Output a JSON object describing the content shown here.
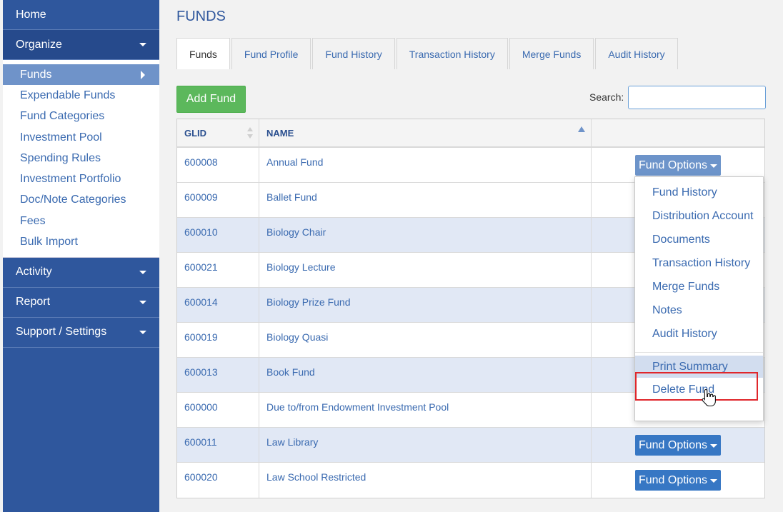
{
  "sidebar": {
    "home": "Home",
    "organize": "Organize",
    "organize_items": [
      "Funds",
      "Expendable Funds",
      "Fund Categories",
      "Investment Pool",
      "Spending Rules",
      "Investment Portfolio",
      "Doc/Note Categories",
      "Fees",
      "Bulk Import"
    ],
    "activity": "Activity",
    "report": "Report",
    "support": "Support / Settings"
  },
  "page": {
    "title": "FUNDS"
  },
  "tabs": [
    "Funds",
    "Fund Profile",
    "Fund History",
    "Transaction History",
    "Merge Funds",
    "Audit History"
  ],
  "toolbar": {
    "add_fund": "Add Fund",
    "search_label": "Search:",
    "search_value": ""
  },
  "table": {
    "headers": {
      "glid": "GLID",
      "name": "NAME"
    },
    "rows": [
      {
        "glid": "600008",
        "name": "Annual Fund"
      },
      {
        "glid": "600009",
        "name": "Ballet Fund"
      },
      {
        "glid": "600010",
        "name": "Biology Chair"
      },
      {
        "glid": "600021",
        "name": "Biology Lecture"
      },
      {
        "glid": "600014",
        "name": "Biology Prize Fund"
      },
      {
        "glid": "600019",
        "name": "Biology Quasi"
      },
      {
        "glid": "600013",
        "name": "Book Fund"
      },
      {
        "glid": "600000",
        "name": "Due to/from Endowment Investment Pool"
      },
      {
        "glid": "600011",
        "name": "Law Library"
      },
      {
        "glid": "600020",
        "name": "Law School Restricted"
      }
    ],
    "action_label": "Fund Options"
  },
  "dropdown": {
    "items": [
      "Fund History",
      "Distribution Account",
      "Documents",
      "Transaction History",
      "Merge Funds",
      "Notes",
      "Audit History"
    ],
    "print_summary": "Print Summary",
    "delete_fund": "Delete Fund"
  },
  "colors": {
    "sidebar": "#2f579d",
    "accent_blue": "#3777c4",
    "add_green": "#5cb85c",
    "alt_row": "#e1e8f5",
    "highlight": "#e0262b"
  },
  "icons": {
    "cursor": "hand-pointer-icon"
  }
}
